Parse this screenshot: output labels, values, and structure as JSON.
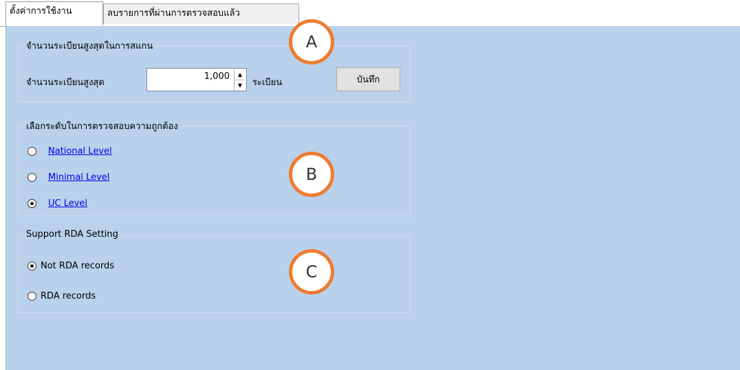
{
  "tabs": [
    {
      "label": "ตั้งค่าการใช้งาน",
      "active": true
    },
    {
      "label": "ลบรายการที่ผ่านการตรวจสอบแล้ว",
      "active": false
    }
  ],
  "scan_group": {
    "legend": "จำนวนระเบียนสูงสุดในการสแกน",
    "max_label": "จำนวนระเบียนสูงสุด",
    "max_value": "1,000",
    "unit_label": "ระเบียน",
    "save_label": "บันทึก",
    "spin_up": "▲",
    "spin_down": "▼"
  },
  "level_group": {
    "legend": "เลือกระดับในการตรวจสอบความถูกต้อง",
    "options": [
      {
        "label": "National Level",
        "selected": false
      },
      {
        "label": "Minimal Level",
        "selected": false
      },
      {
        "label": "UC Level",
        "selected": true
      }
    ]
  },
  "rda_group": {
    "legend": "Support RDA Setting",
    "options": [
      {
        "label": "Not RDA records",
        "selected": true
      },
      {
        "label": "RDA records",
        "selected": false
      }
    ]
  },
  "markers": [
    "A",
    "B",
    "C"
  ],
  "colors": {
    "panel_bg": "#b9d1ea",
    "marker_border": "#ed7d31",
    "link": "#0000ee"
  }
}
